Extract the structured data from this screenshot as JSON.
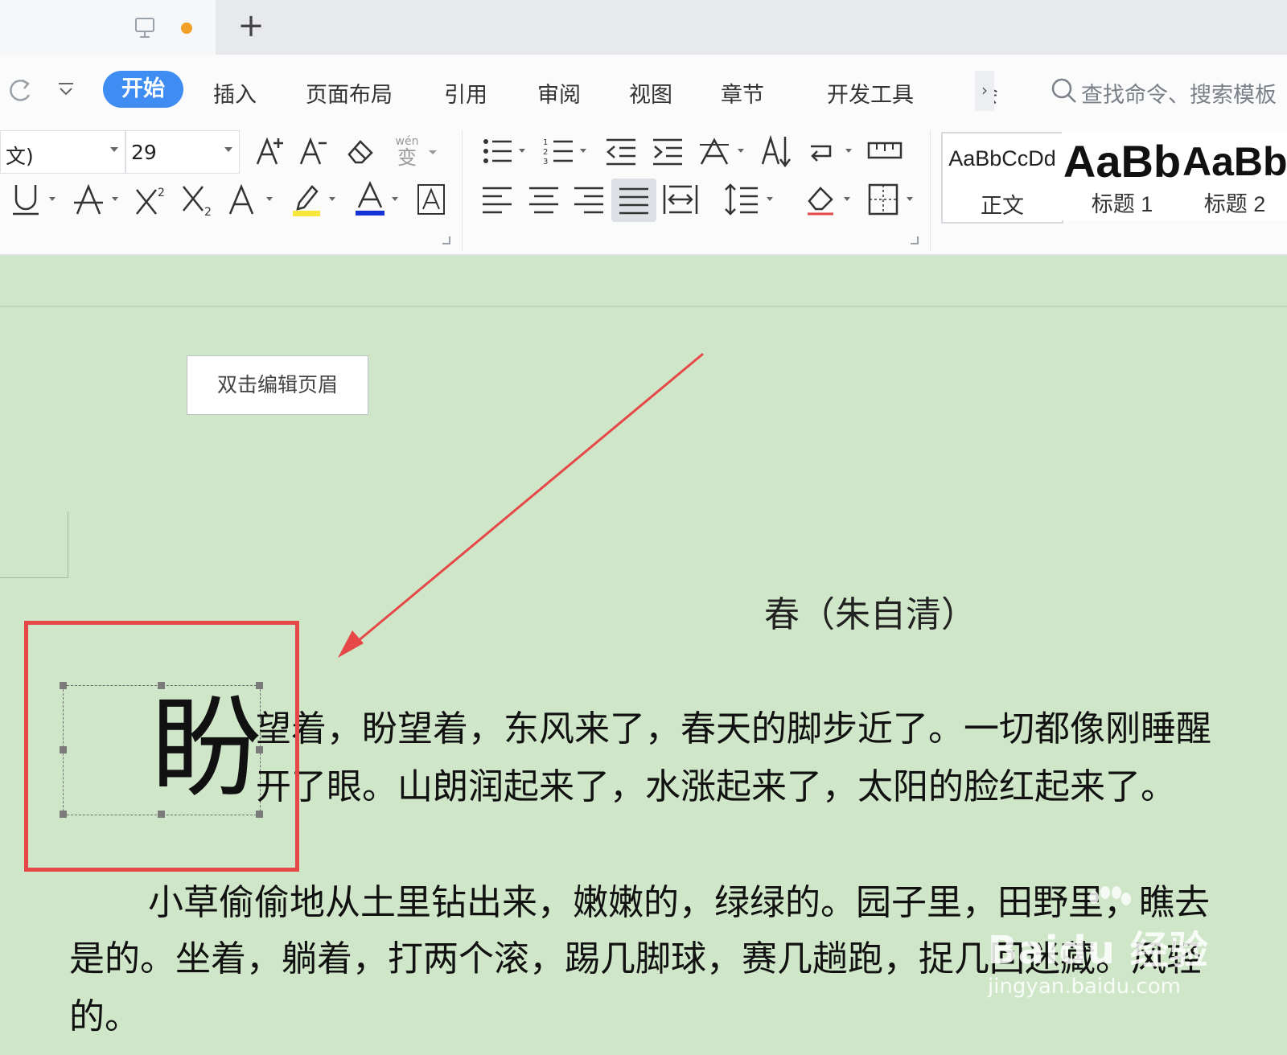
{
  "tabs": {
    "new_tab_label": "+"
  },
  "menu": {
    "start": "开始",
    "insert": "插入",
    "page_layout": "页面布局",
    "references": "引用",
    "review": "审阅",
    "view": "视图",
    "chapter": "章节",
    "developer": "开发工具",
    "more_partial": "会",
    "more_arrow": "›"
  },
  "search": {
    "placeholder": "查找命令、搜索模板"
  },
  "font": {
    "name": "文)",
    "size": "29"
  },
  "icons": {
    "pinyin": "wén",
    "pinyin_char": "变",
    "highlight_color": "#f5e83a",
    "font_color": "#1432d6"
  },
  "styles": [
    {
      "sample": "AaBbCcDd",
      "name": "正文"
    },
    {
      "sample": "AaBb",
      "name": "标题 1"
    },
    {
      "sample": "AaBb",
      "name": "标题 2"
    }
  ],
  "document": {
    "header_hint": "双击编辑页眉",
    "title": "春（朱自清）",
    "drop_cap": "盼",
    "para1_line1": "望着，盼望着，东风来了，春天的脚步近了。一切都像刚睡醒",
    "para1_line2": "开了眼。山朗润起来了，水涨起来了，太阳的脸红起来了。",
    "para2_line1": "小草偷偷地从土里钻出来，嫩嫩的，绿绿的。园子里，田野里，瞧去",
    "para2_line2": "是的。坐着，躺着，打两个滚，踢几脚球，赛几趟跑，捉几回迷藏。风轻",
    "para2_line3": "的。"
  },
  "watermark": {
    "brand": "Baidu 经验",
    "url": "jingyan.baidu.com"
  },
  "colors": {
    "accent": "#3f8cf2",
    "page_bg": "#cfe6c8",
    "annotation_red": "#e64747"
  }
}
